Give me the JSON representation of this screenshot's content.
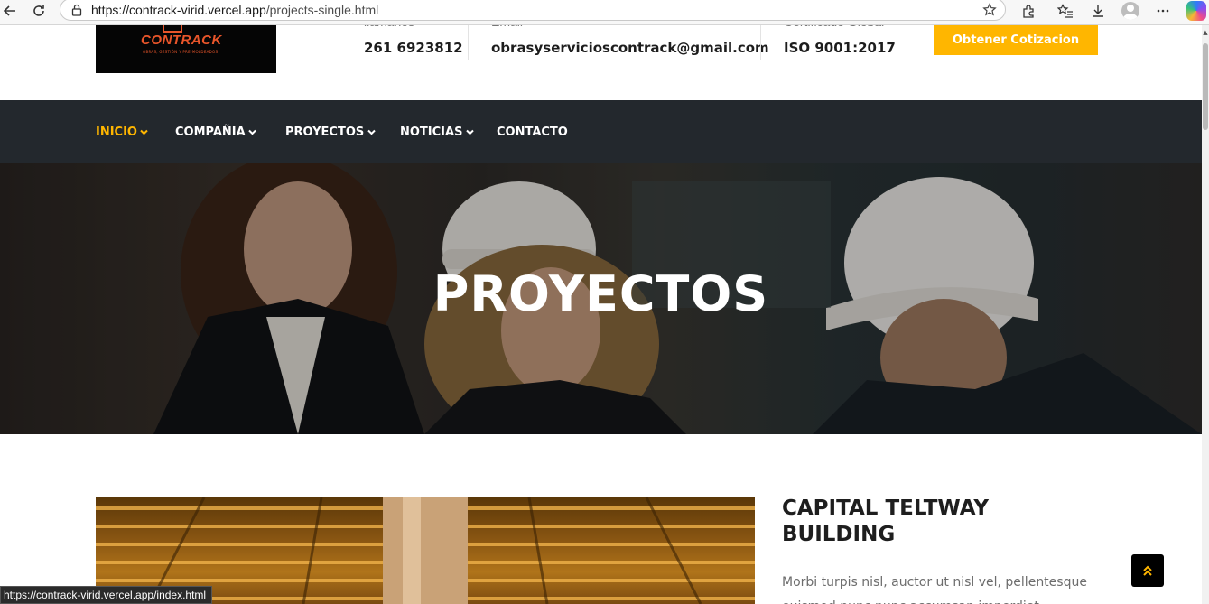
{
  "browser": {
    "url_host": "https://contrack-virid.vercel.app",
    "url_path": "/projects-single.html",
    "icons": [
      "back-icon",
      "reload-icon",
      "lock-icon",
      "star-icon",
      "extensions-icon",
      "favorites-icon",
      "download-icon",
      "profile-icon",
      "more-icon",
      "copilot-icon"
    ],
    "status_url": "https://contrack-virid.vercel.app/index.html"
  },
  "header": {
    "logo_text": "CONTRACK",
    "logo_tagline": "OBRAS, GESTIÓN Y PRE-MOLDEADOS",
    "phone": {
      "label": "llamanos",
      "value": "261 6923812"
    },
    "email": {
      "label": "Email",
      "value": "obrasyservicioscontrack@gmail.com"
    },
    "certificate": {
      "label": "Certificado Global",
      "value": "ISO 9001:2017"
    },
    "quote_button": "Obtener Cotizacion"
  },
  "nav": {
    "items": [
      {
        "label": "INICIO",
        "active": true
      },
      {
        "label": "COMPAÑIA",
        "active": false
      },
      {
        "label": "PROYECTOS",
        "active": false
      },
      {
        "label": "NOTICIAS",
        "active": false
      },
      {
        "label": "CONTACTO",
        "active": false
      }
    ]
  },
  "hero": {
    "title": "PROYECTOS"
  },
  "project": {
    "title": "CAPITAL TELTWAY BUILDING",
    "description": "Morbi turpis nisl, auctor ut nisl vel, pellentesque euismod nunc nunc accumsan imperdiet"
  },
  "colors": {
    "accent": "#ffb600",
    "navbar": "#23282d",
    "text_dark": "#1e1e1e",
    "text_muted": "#6d6d6d"
  }
}
